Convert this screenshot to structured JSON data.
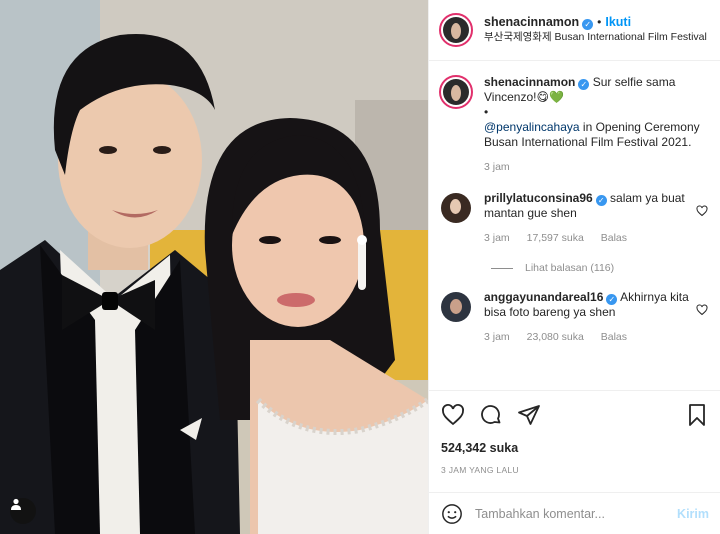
{
  "post": {
    "username": "shenacinnamon",
    "follow_label": "Ikuti",
    "dot": "•",
    "location": "부산국제영화제 Busan International Film Festival",
    "verified_icon": "✓"
  },
  "caption": {
    "username": "shenacinnamon",
    "text": "Sur selfie sama Vincenzo!😋💚",
    "bullet": "•",
    "mention": "@penyalincahaya",
    "text2": " in Opening Ceremony Busan International Film Festival 2021.",
    "time": "3 jam"
  },
  "comments": [
    {
      "username": "prillylatuconsina96",
      "text": " salam ya buat mantan gue shen",
      "time": "3 jam",
      "likes": "17,597 suka",
      "reply": "Balas",
      "view_replies": "Lihat balasan (116)"
    },
    {
      "username": "anggayunandareal16",
      "text": " Akhirnya kita bisa foto bareng ya shen",
      "time": "3 jam",
      "likes": "23,080 suka",
      "reply": "Balas"
    }
  ],
  "footer": {
    "likes": "524,342 suka",
    "timestamp": "3 JAM YANG LALU",
    "comment_placeholder": "Tambahkan komentar...",
    "post_label": "Kirim"
  },
  "colors": {
    "accent": "#0095f6",
    "verified": "#3897f0",
    "post_disabled": "#b2dffc"
  }
}
